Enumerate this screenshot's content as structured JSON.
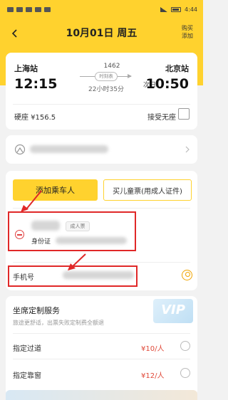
{
  "status": {
    "time": "4:44"
  },
  "nav": {
    "title": "10月01日 周五",
    "right_label_line1": "购买",
    "right_label_line2": "添加"
  },
  "trip": {
    "from_station": "上海站",
    "depart_time": "12:15",
    "train_no": "1462",
    "timetable_tag": "时刻表",
    "duration": "22小时35分",
    "to_station": "北京站",
    "next_day": "次日",
    "arrive_time": "10:50",
    "seat_price": "硬座 ¥156.5",
    "accept_no_seat": "接受无座"
  },
  "passenger": {
    "add_button": "添加乘车人",
    "child_button": "买儿童票(用成人证件)",
    "ticket_type": "成人票",
    "id_label": "身份证",
    "phone_label": "手机号"
  },
  "service": {
    "title": "坐席定制服务",
    "subtitle": "旅途更舒适，出票失败定制费全额退",
    "vip": "VIP",
    "options": [
      {
        "label": "指定过道",
        "price": "¥10/人"
      },
      {
        "label": "指定靠窗",
        "price": "¥12/人"
      }
    ]
  },
  "colors": {
    "brand": "#ffd22e",
    "highlight": "#e02828",
    "price": "#e04a3a"
  }
}
